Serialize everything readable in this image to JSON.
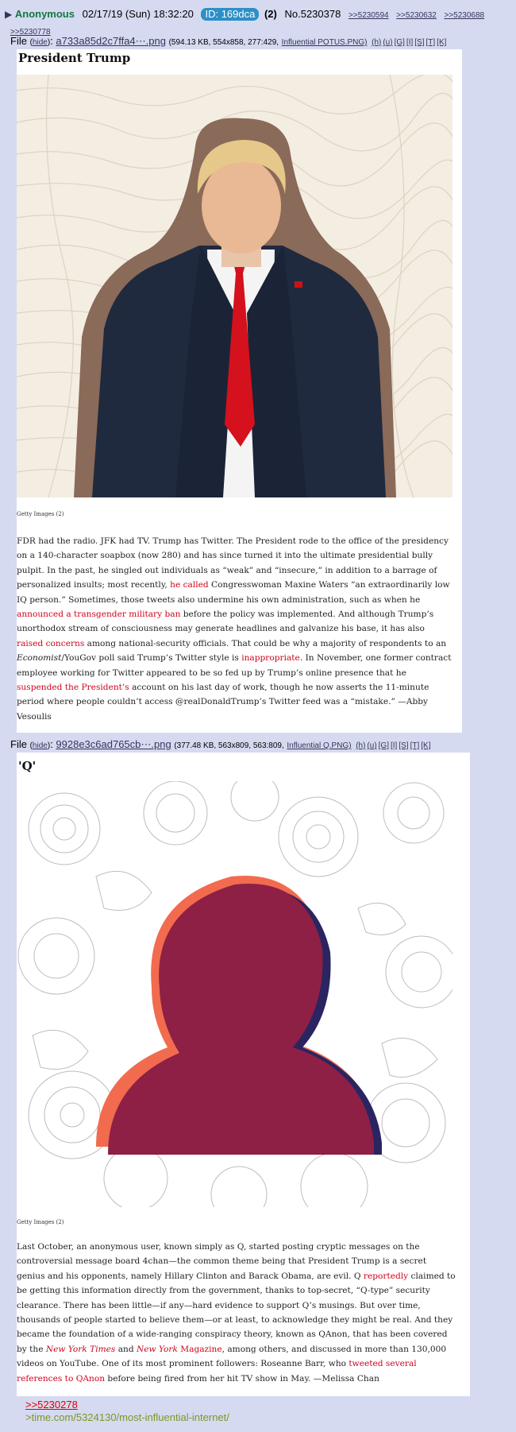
{
  "post": {
    "arrow": "▶",
    "name": "Anonymous",
    "datetime": "02/17/19 (Sun) 18:32:20",
    "id_label": "ID: 169dca",
    "count": "(2)",
    "number": "No.5230378",
    "backlinks": [
      ">>5230594",
      ">>5230632",
      ">>5230688",
      ">>5230778"
    ]
  },
  "files": [
    {
      "prefix": "File",
      "hide": "hide",
      "name": "a733a85d2c7ffa4⋯.png",
      "meta": "(594.13 KB, 554x858, 277:429,",
      "orig": "Influential POTUS.PNG)",
      "links": [
        "(h)",
        "(u)",
        "[G]",
        "[I]",
        "[S]",
        "[T]",
        "[K]"
      ]
    },
    {
      "prefix": "File",
      "hide": "hide",
      "name": "9928e3c6ad765cb⋯.png",
      "meta": "(377.48 KB, 563x809, 563:809,",
      "orig": "Influential Q.PNG)",
      "links": [
        "(h)",
        "(u)",
        "[G]",
        "[I]",
        "[S]",
        "[T]",
        "[K]"
      ]
    }
  ],
  "article1": {
    "title": "President Trump",
    "credit": "Getty Images (2)",
    "p": [
      "FDR had the radio. JFK had TV. Trump has Twitter. The President rode to the office of the presidency on a 140-character soapbox (now 280) and has since turned it into the ultimate presidential bully pulpit. In the past, he singled out individuals as “weak” and “insecure,” in addition to a barrage of personalized insults; most recently, ",
      "he called",
      " Congresswoman Maxine Waters “an extraordinarily low IQ person.” Sometimes, those tweets also undermine his own administration, such as when he ",
      "announced a transgender military ban",
      " before the policy was implemented. And although Trump’s unorthodox stream of consciousness may generate headlines and galvanize his base, it has also ",
      "raised concerns",
      " among national-security officials. That could be why a majority of respondents to an ",
      "Economist",
      "/YouGov poll said Trump’s Twitter style is ",
      "inappropriate",
      ". In November, one former contract employee working for Twitter appeared to be so fed up by Trump’s online presence that he ",
      "suspended the President’s",
      " account on his last day of work, though he now asserts the 11-minute period where people couldn’t access @realDonaldTrump’s Twitter feed was a “mistake.” —Abby Vesoulis"
    ]
  },
  "article2": {
    "title": "'Q'",
    "credit": "Getty Images (2)",
    "p": [
      "Last October, an anonymous user, known simply as Q, started posting cryptic messages on the controversial message board 4chan—the common theme being that President Trump is a secret genius and his opponents, namely Hillary Clinton and Barack Obama, are evil. Q ",
      "reportedly",
      " claimed to be getting this information directly from the government, thanks to top-secret, “Q-type” security clearance. There has been little—if any—hard evidence to support Q’s musings. But over time, thousands of people started to believe them—or at least, to acknowledge they might be real. And they became the foundation of a wide-ranging conspiracy theory, known as QAnon, that has been covered by the ",
      "New York Times",
      " and ",
      "New York",
      " ",
      "Magazine",
      ", among others, and discussed in more than 130,000 videos on YouTube. One of its most prominent followers: Roseanne Barr, who ",
      "tweeted several references to QAnon",
      " before being fired from her hit TV show in May. —Melissa Chan"
    ]
  },
  "quote": {
    "link": ">>5230278",
    "greentext": ">time.com/5324130/most-influential-internet/"
  },
  "colors": {
    "page_bg": "#d6daf0",
    "name": "#117743",
    "id_badge": "#2d8fc7",
    "link_red": "#d0021b",
    "greentext": "#789922",
    "silhouette": "#8e1f45",
    "silhouette_orange": "#f26b4f"
  }
}
